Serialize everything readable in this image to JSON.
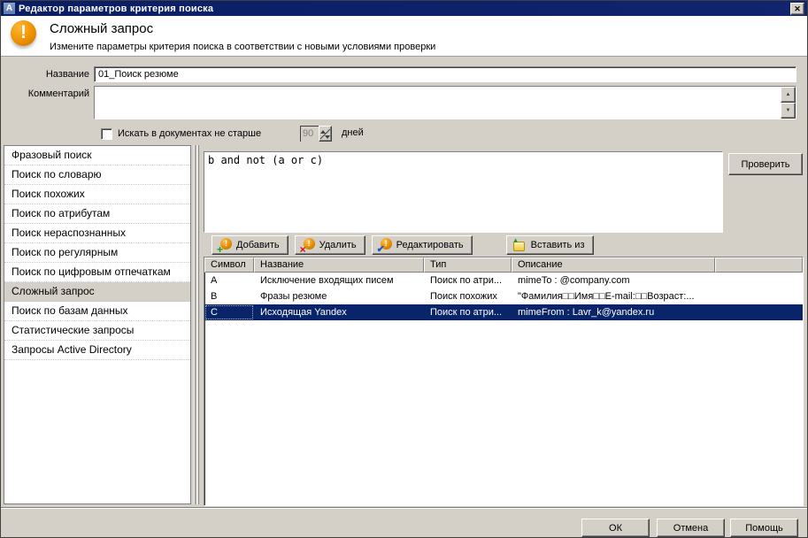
{
  "window": {
    "title": "Редактор параметров критерия поиска",
    "app_icon_letter": "A",
    "close_glyph": "✕"
  },
  "header": {
    "title": "Сложный запрос",
    "subtitle": "Измените параметры критерия поиска в соответствии с новыми условиями проверки",
    "warning_glyph": "!"
  },
  "form": {
    "name_label": "Название",
    "name_value": "01_Поиск резюме",
    "comment_label": "Комментарий",
    "comment_value": "",
    "age_checkbox_label": "Искать в документах не старше",
    "age_value": "90",
    "age_suffix": "дней"
  },
  "sidebar": {
    "items": [
      {
        "label": "Фразовый поиск",
        "selected": false
      },
      {
        "label": "Поиск по словарю",
        "selected": false
      },
      {
        "label": "Поиск похожих",
        "selected": false
      },
      {
        "label": "Поиск по атрибутам",
        "selected": false
      },
      {
        "label": "Поиск нераспознанных",
        "selected": false
      },
      {
        "label": "Поиск по регулярным",
        "selected": false
      },
      {
        "label": "Поиск по цифровым отпечаткам",
        "selected": false
      },
      {
        "label": "Сложный запрос",
        "selected": true
      },
      {
        "label": "Поиск по базам данных",
        "selected": false
      },
      {
        "label": "Статистические запросы",
        "selected": false
      },
      {
        "label": "Запросы Active Directory",
        "selected": false
      }
    ]
  },
  "query": {
    "text": "b and not (a or c)",
    "check_button": "Проверить"
  },
  "toolbar": {
    "add": "Добавить",
    "delete": "Удалить",
    "edit": "Редактировать",
    "paste_from": "Вставить из"
  },
  "table": {
    "columns": [
      "Символ",
      "Название",
      "Тип",
      "Описание"
    ],
    "rows": [
      {
        "symbol": "A",
        "name": "Исключение входящих писем",
        "type": "Поиск по атри...",
        "description": "mimeTo : @company.com",
        "selected": false
      },
      {
        "symbol": "B",
        "name": "Фразы резюме",
        "type": "Поиск похожих",
        "description": "\"Фамилия□□Имя□□E-mail:□□Возраст:...",
        "selected": false
      },
      {
        "symbol": "C",
        "name": "Исходящая Yandex",
        "type": "Поиск по атри...",
        "description": "mimeFrom : Lavr_k@yandex.ru",
        "selected": true
      }
    ]
  },
  "footer": {
    "ok": "ОК",
    "cancel": "Отмена",
    "help": "Помощь"
  },
  "colors": {
    "titlebar": "#0a1e66",
    "selection": "#0a246a",
    "dialog_bg": "#d4d0c8",
    "warning_orange": "#ef9000"
  }
}
